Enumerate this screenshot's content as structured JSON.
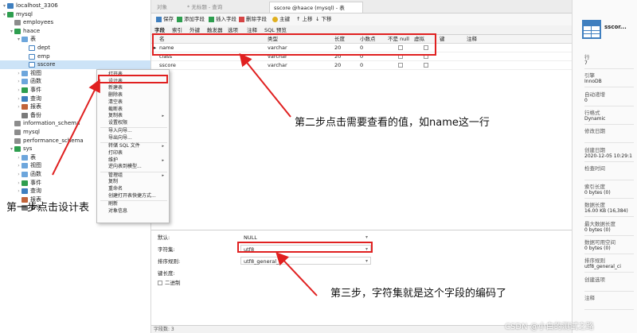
{
  "tree": [
    {
      "label": "localhost_3306",
      "icon": "server-icon",
      "level": 0,
      "arrow": "▾",
      "cls": "ic-server"
    },
    {
      "label": "mysql",
      "icon": "database-icon",
      "level": 0,
      "arrow": "▾",
      "cls": "ic-db-on"
    },
    {
      "label": "employees",
      "icon": "database-icon",
      "level": 1,
      "arrow": "",
      "cls": "ic-db"
    },
    {
      "label": "haace",
      "icon": "database-icon",
      "level": 1,
      "arrow": "▾",
      "cls": "ic-db-on"
    },
    {
      "label": "表",
      "icon": "folder-icon",
      "level": 2,
      "arrow": "▾",
      "cls": "ic-folder"
    },
    {
      "label": "dept",
      "icon": "table-icon",
      "level": 3,
      "arrow": "",
      "cls": "ic-table"
    },
    {
      "label": "emp",
      "icon": "table-icon",
      "level": 3,
      "arrow": "",
      "cls": "ic-table"
    },
    {
      "label": "sscore",
      "icon": "table-icon",
      "level": 3,
      "arrow": "",
      "cls": "ic-table",
      "selected": true
    },
    {
      "label": "视图",
      "icon": "view-icon",
      "level": 2,
      "arrow": "›",
      "cls": "ic-folder"
    },
    {
      "label": "函数",
      "icon": "function-icon",
      "level": 2,
      "arrow": "›",
      "cls": "ic-folder"
    },
    {
      "label": "事件",
      "icon": "event-icon",
      "level": 2,
      "arrow": "›",
      "cls": "ic-green"
    },
    {
      "label": "查询",
      "icon": "query-icon",
      "level": 2,
      "arrow": "›",
      "cls": "ic-query"
    },
    {
      "label": "报表",
      "icon": "report-icon",
      "level": 2,
      "arrow": "›",
      "cls": "ic-report"
    },
    {
      "label": "备份",
      "icon": "backup-icon",
      "level": 2,
      "arrow": "",
      "cls": "ic-backup"
    },
    {
      "label": "information_schema",
      "icon": "database-icon",
      "level": 1,
      "arrow": "",
      "cls": "ic-db"
    },
    {
      "label": "mysql",
      "icon": "database-icon",
      "level": 1,
      "arrow": "",
      "cls": "ic-db"
    },
    {
      "label": "performance_schema",
      "icon": "database-icon",
      "level": 1,
      "arrow": "",
      "cls": "ic-db"
    },
    {
      "label": "sys",
      "icon": "database-icon",
      "level": 1,
      "arrow": "▾",
      "cls": "ic-db-on"
    },
    {
      "label": "表",
      "icon": "folder-icon",
      "level": 2,
      "arrow": "›",
      "cls": "ic-folder"
    },
    {
      "label": "视图",
      "icon": "view-icon",
      "level": 2,
      "arrow": "›",
      "cls": "ic-folder"
    },
    {
      "label": "函数",
      "icon": "function-icon",
      "level": 2,
      "arrow": "›",
      "cls": "ic-folder"
    },
    {
      "label": "事件",
      "icon": "event-icon",
      "level": 2,
      "arrow": "›",
      "cls": "ic-green"
    },
    {
      "label": "查询",
      "icon": "query-icon",
      "level": 2,
      "arrow": "›",
      "cls": "ic-query"
    },
    {
      "label": "报表",
      "icon": "report-icon",
      "level": 2,
      "arrow": "",
      "cls": "ic-report"
    },
    {
      "label": "备份",
      "icon": "backup-icon",
      "level": 2,
      "arrow": "",
      "cls": "ic-backup"
    }
  ],
  "tabs": {
    "objects": "对象",
    "untitled_query": "* 无标题 - 查询",
    "sscore_table": "sscore @haace (mysql) - 表"
  },
  "toolbar": {
    "save": "保存",
    "add_field": "添加字段",
    "insert_field": "插入字段",
    "delete_field": "删除字段",
    "primary_key": "主键",
    "move_up": "上移",
    "move_down": "下移"
  },
  "subtabs": [
    "字段",
    "索引",
    "外键",
    "触发器",
    "选项",
    "注释",
    "SQL 预览"
  ],
  "grid": {
    "headers": [
      "名",
      "类型",
      "长度",
      "小数点",
      "不是 null",
      "虚拟",
      "键",
      "注释"
    ],
    "rows": [
      {
        "marker": "▸",
        "name": "name",
        "type": "varchar",
        "length": "20",
        "decimals": "0"
      },
      {
        "marker": "",
        "name": "class",
        "type": "varchar",
        "length": "20",
        "decimals": "0"
      },
      {
        "marker": "",
        "name": "sscore",
        "type": "varchar",
        "length": "20",
        "decimals": "0"
      }
    ]
  },
  "bottom": {
    "default_label": "默认:",
    "default_value": "NULL",
    "charset_label": "字符集:",
    "charset_value": "utf8",
    "collation_label": "排序规则:",
    "collation_value": "utf8_general_ci",
    "keylen_label": "键长度:",
    "binary_label": "二进制"
  },
  "statusbar": "字段数: 3",
  "info": {
    "title": "sscor...",
    "items": [
      {
        "label": "行",
        "value": "7"
      },
      {
        "label": "引擎",
        "value": "InnoDB"
      },
      {
        "label": "自动递增",
        "value": "0"
      },
      {
        "label": "行格式",
        "value": "Dynamic"
      },
      {
        "label": "修改日期",
        "value": ""
      },
      {
        "label": "创建日期",
        "value": "2020-12-05 10:29:1"
      },
      {
        "label": "检查时间",
        "value": ""
      },
      {
        "label": "索引长度",
        "value": "0 bytes (0)"
      },
      {
        "label": "数据长度",
        "value": "16.00 KB (16,384)"
      },
      {
        "label": "最大数据长度",
        "value": "0 bytes (0)"
      },
      {
        "label": "数据可用空间",
        "value": "0 bytes (0)"
      },
      {
        "label": "排序规则",
        "value": "utf8_general_ci"
      },
      {
        "label": "创建选项",
        "value": ""
      },
      {
        "label": "注释",
        "value": ""
      }
    ]
  },
  "menu": [
    {
      "label": "打开表",
      "sub": false,
      "sep_after": false
    },
    {
      "label": "设计表",
      "sub": false,
      "sep_after": false
    },
    {
      "label": "新建表",
      "sub": false,
      "sep_after": false
    },
    {
      "label": "删除表",
      "sub": false,
      "sep_after": false
    },
    {
      "label": "清空表",
      "sub": false,
      "sep_after": false
    },
    {
      "label": "截断表",
      "sub": false,
      "sep_after": false
    },
    {
      "label": "复制表",
      "sub": true,
      "sep_after": false
    },
    {
      "label": "设置权限",
      "sub": false,
      "sep_after": true
    },
    {
      "label": "导入向导...",
      "sub": false,
      "sep_after": false
    },
    {
      "label": "导出向导...",
      "sub": false,
      "sep_after": true
    },
    {
      "label": "转储 SQL 文件",
      "sub": true,
      "sep_after": false
    },
    {
      "label": "打印表",
      "sub": false,
      "sep_after": false
    },
    {
      "label": "维护",
      "sub": true,
      "sep_after": false
    },
    {
      "label": "逆向表到模型...",
      "sub": false,
      "sep_after": true
    },
    {
      "label": "管理组",
      "sub": true,
      "sep_after": false
    },
    {
      "label": "复制",
      "sub": false,
      "sep_after": false
    },
    {
      "label": "重命名",
      "sub": false,
      "sep_after": false
    },
    {
      "label": "创建打开表快捷方式...",
      "sub": false,
      "sep_after": true
    },
    {
      "label": "刷新",
      "sub": false,
      "sep_after": false
    },
    {
      "label": "对象信息",
      "sub": false,
      "sep_after": false
    }
  ],
  "annotations": {
    "step1": "第一步点击设计表",
    "step2": "第二步点击需要查看的值，如name这一行",
    "step3": "第三步，字符集就是这个字段的编码了"
  },
  "watermark": "CSDN @小白的测试之路",
  "colors": {
    "annotation": "#e02020",
    "selection": "#cce3f7"
  }
}
